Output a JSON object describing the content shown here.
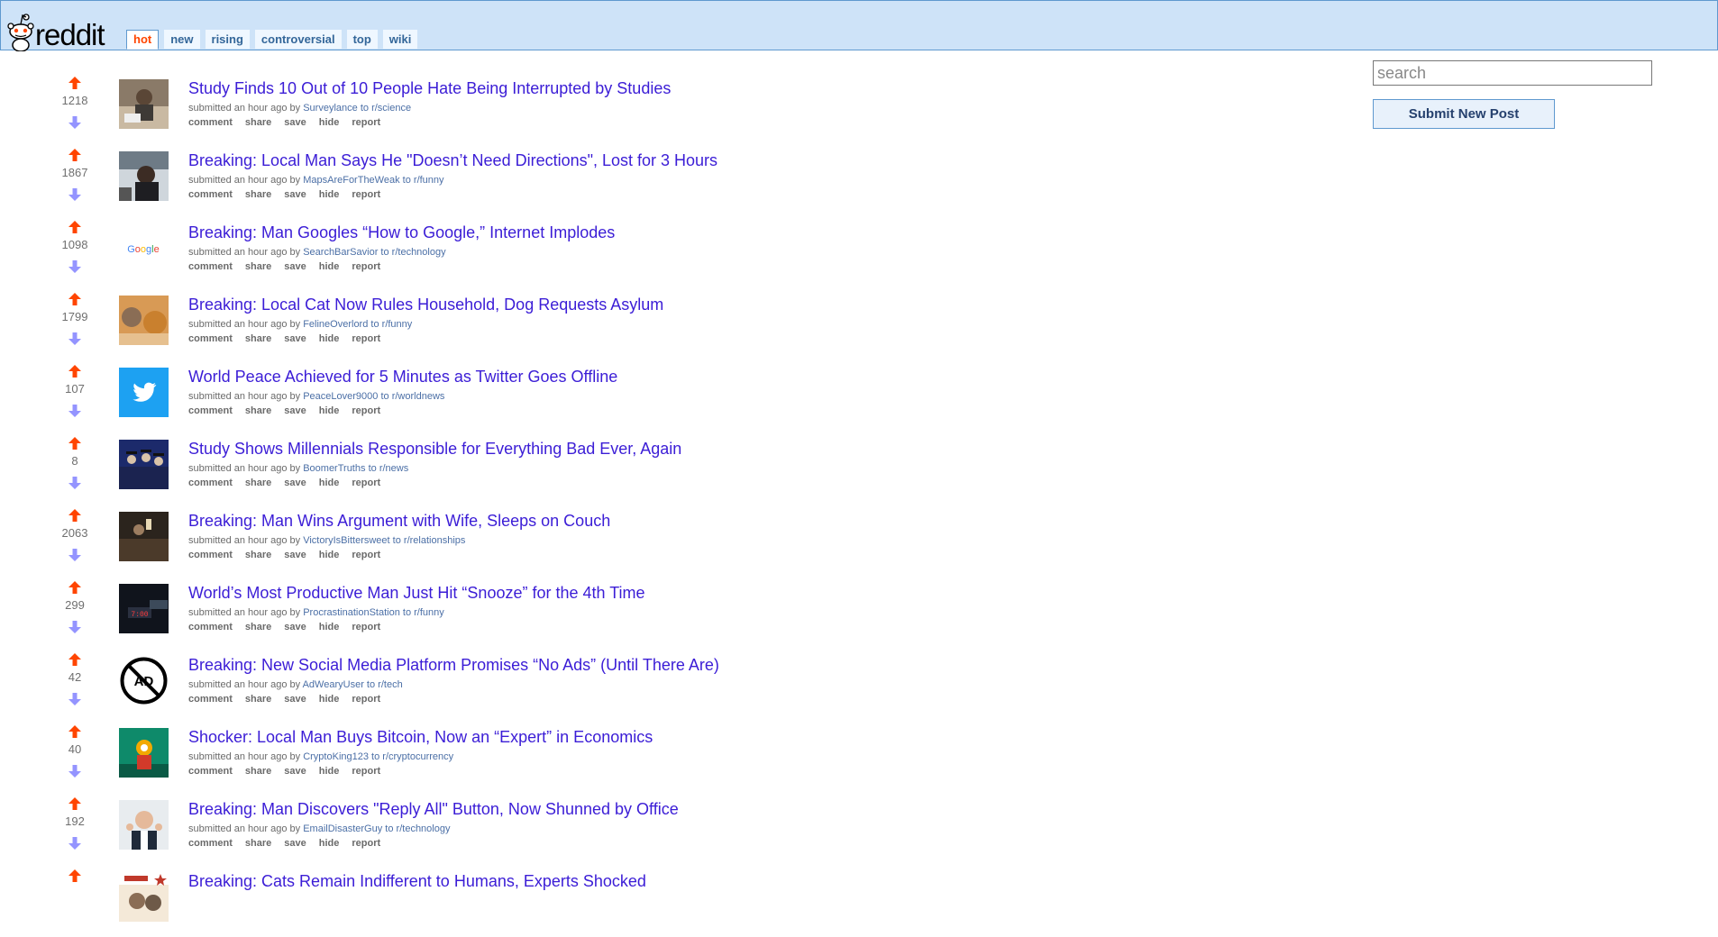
{
  "header": {
    "logo_text": "reddit",
    "tabs": [
      {
        "label": "hot",
        "active": true
      },
      {
        "label": "new"
      },
      {
        "label": "rising"
      },
      {
        "label": "controversial"
      },
      {
        "label": "top"
      },
      {
        "label": "wiki"
      }
    ]
  },
  "sidebar": {
    "search_placeholder": "search",
    "submit_label": "Submit New Post"
  },
  "actions": [
    "comment",
    "share",
    "save",
    "hide",
    "report"
  ],
  "posts": [
    {
      "score": "1218",
      "title": "Study Finds 10 Out of 10 People Hate Being Interrupted by Studies",
      "submitted": "submitted an hour ago by",
      "author": "Surveylance",
      "to": "to",
      "subreddit": "r/science",
      "thumb": "photo-person-desk"
    },
    {
      "score": "1867",
      "title": "Breaking: Local Man Says He \"Doesn’t Need Directions\", Lost for 3 Hours",
      "submitted": "submitted an hour ago by",
      "author": "MapsAreForTheWeak",
      "to": "to",
      "subreddit": "r/funny",
      "thumb": "photo-man-in-car"
    },
    {
      "score": "1098",
      "title": "Breaking: Man Googles “How to Google,” Internet Implodes",
      "submitted": "submitted an hour ago by",
      "author": "SearchBarSavior",
      "to": "to",
      "subreddit": "r/technology",
      "thumb": "google-logo",
      "thumb_text": "Google"
    },
    {
      "score": "1799",
      "title": "Breaking: Local Cat Now Rules Household, Dog Requests Asylum",
      "submitted": "submitted an hour ago by",
      "author": "FelineOverlord",
      "to": "to",
      "subreddit": "r/funny",
      "thumb": "photo-cat-and-dog"
    },
    {
      "score": "107",
      "title": "World Peace Achieved for 5 Minutes as Twitter Goes Offline",
      "submitted": "submitted an hour ago by",
      "author": "PeaceLover9000",
      "to": "to",
      "subreddit": "r/worldnews",
      "thumb": "twitter-bird"
    },
    {
      "score": "8",
      "title": "Study Shows Millennials Responsible for Everything Bad Ever, Again",
      "submitted": "submitted an hour ago by",
      "author": "BoomerTruths",
      "to": "to",
      "subreddit": "r/news",
      "thumb": "photo-graduates"
    },
    {
      "score": "2063",
      "title": "Breaking: Man Wins Argument with Wife, Sleeps on Couch",
      "submitted": "submitted an hour ago by",
      "author": "VictoryIsBittersweet",
      "to": "to",
      "subreddit": "r/relationships",
      "thumb": "photo-couch-dark"
    },
    {
      "score": "299",
      "title": "World’s Most Productive Man Just Hit “Snooze” for the 4th Time",
      "submitted": "submitted an hour ago by",
      "author": "ProcrastinationStation",
      "to": "to",
      "subreddit": "r/funny",
      "thumb": "photo-alarm-clock"
    },
    {
      "score": "42",
      "title": "Breaking: New Social Media Platform Promises “No Ads” (Until There Are)",
      "submitted": "submitted an hour ago by",
      "author": "AdWearyUser",
      "to": "to",
      "subreddit": "r/tech",
      "thumb": "no-ads-icon",
      "thumb_text": "AD"
    },
    {
      "score": "40",
      "title": "Shocker: Local Man Buys Bitcoin, Now an “Expert” in Economics",
      "submitted": "submitted an hour ago by",
      "author": "CryptoKing123",
      "to": "to",
      "subreddit": "r/cryptocurrency",
      "thumb": "photo-bitcoin-figure"
    },
    {
      "score": "192",
      "title": "Breaking: Man Discovers \"Reply All\" Button, Now Shunned by Office",
      "submitted": "submitted an hour ago by",
      "author": "EmailDisasterGuy",
      "to": "to",
      "subreddit": "r/technology",
      "thumb": "photo-shocked-man"
    },
    {
      "score": "",
      "title": "Breaking: Cats Remain Indifferent to Humans, Experts Shocked",
      "submitted": "",
      "author": "",
      "to": "",
      "subreddit": "",
      "thumb": "photo-cats-sign"
    }
  ],
  "colors": {
    "header_bg": "#cee3f8",
    "upvote": "#ff4500",
    "downvote": "#9494ff",
    "title": "#3b1dd6",
    "link": "#4b6fa6"
  }
}
